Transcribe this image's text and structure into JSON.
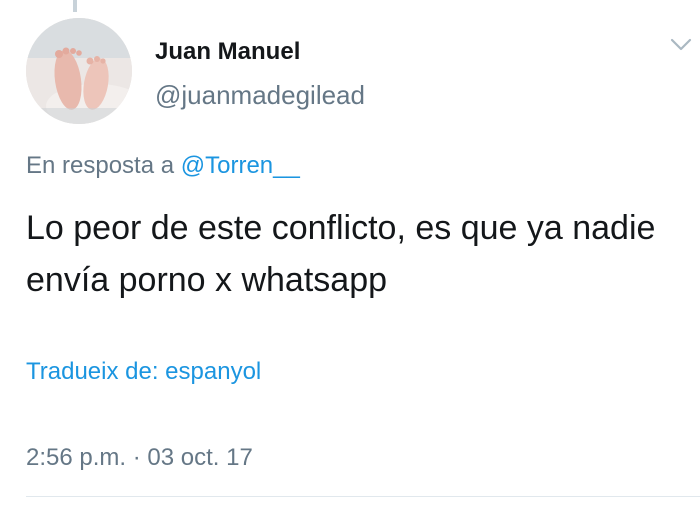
{
  "thread_line_color": "#c8d2d9",
  "author": {
    "name": "Juan Manuel",
    "handle": "@juanmadegilead",
    "avatar_icon": "baby-feet-photo"
  },
  "menu_icon": "chevron-down-icon",
  "reply": {
    "prefix": "En resposta a",
    "mention": "@Torren__"
  },
  "tweet": {
    "text": "Lo peor de este conflicto, es que ya nadie envía porno x whatsapp"
  },
  "translate_label": "Tradueix de: espanyol",
  "timestamp": "2:56 p.m. · 03 oct. 17",
  "colors": {
    "link": "#1b95e0",
    "secondary_text": "#657786",
    "primary_text": "#14171a"
  }
}
